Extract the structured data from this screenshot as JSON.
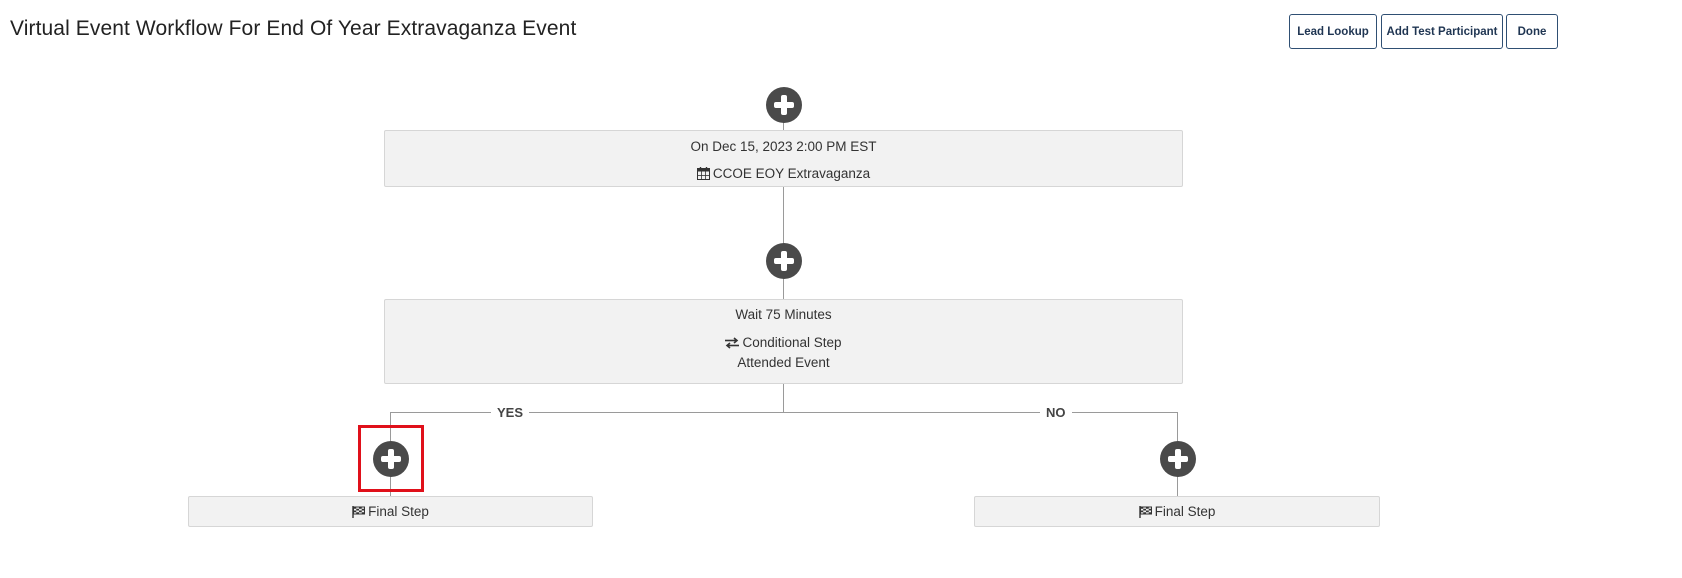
{
  "header": {
    "title": "Virtual Event Workflow For End Of Year Extravaganza Event",
    "buttons": {
      "lead_lookup": "Lead Lookup",
      "add_test_participant": "Add Test Participant",
      "done": "Done"
    }
  },
  "workflow": {
    "event_step": {
      "date": "On Dec 15, 2023 2:00 PM EST",
      "event_name": "CCOE EOY Extravaganza",
      "icon": "calendar-icon"
    },
    "wait_step": {
      "label": "Wait 75 Minutes",
      "condition_type": "Conditional Step",
      "condition": "Attended Event",
      "icon": "exchange-arrows-icon"
    },
    "branches": {
      "yes": {
        "label": "YES",
        "final_step": "Final Step",
        "icon": "checkered-flag-icon"
      },
      "no": {
        "label": "NO",
        "final_step": "Final Step",
        "icon": "checkered-flag-icon"
      }
    }
  },
  "colors": {
    "button_border": "#2f4f73",
    "plus_button": "#4a4a4a",
    "step_background": "#f2f2f2",
    "connector": "#9a9a9a",
    "highlight": "#e0101a"
  }
}
